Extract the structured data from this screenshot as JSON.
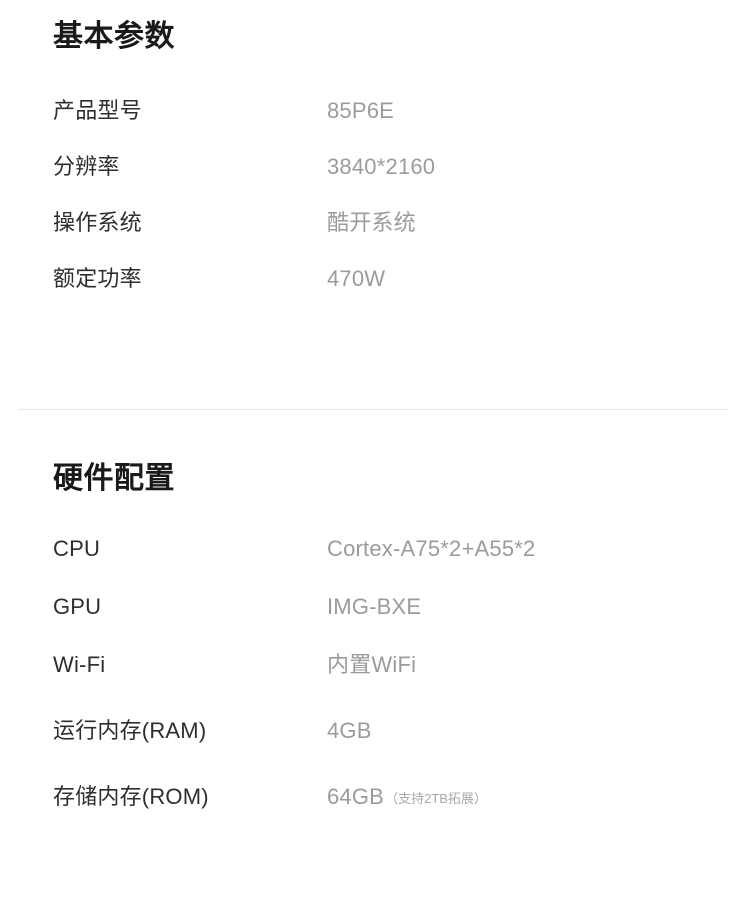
{
  "page": {
    "background_color": "#ffffff",
    "label_color": "#2e2e2e",
    "value_color": "#9b9b9b",
    "title_color": "#1a1a1a",
    "divider_color": "#e6e6e6"
  },
  "sections": [
    {
      "id": "basic-parameters",
      "title": "基本参数",
      "rows": [
        {
          "label": "产品型号",
          "value": "85P6E",
          "note": ""
        },
        {
          "label": "分辨率",
          "value": "3840*2160",
          "note": ""
        },
        {
          "label": "操作系统",
          "value": "酷开系统",
          "note": ""
        },
        {
          "label": "额定功率",
          "value": "470W",
          "note": ""
        }
      ]
    },
    {
      "id": "hardware-configuration",
      "title": "硬件配置",
      "rows": [
        {
          "label": "CPU",
          "value": "Cortex-A75*2+A55*2",
          "note": ""
        },
        {
          "label": "GPU",
          "value": "IMG-BXE",
          "note": ""
        },
        {
          "label": "Wi-Fi",
          "value": "内置WiFi",
          "note": ""
        },
        {
          "label": "运行内存(RAM)",
          "value": "4GB",
          "note": ""
        },
        {
          "label": "存储内存(ROM)",
          "value": "64GB",
          "note": "（支持2TB拓展）"
        }
      ]
    }
  ]
}
